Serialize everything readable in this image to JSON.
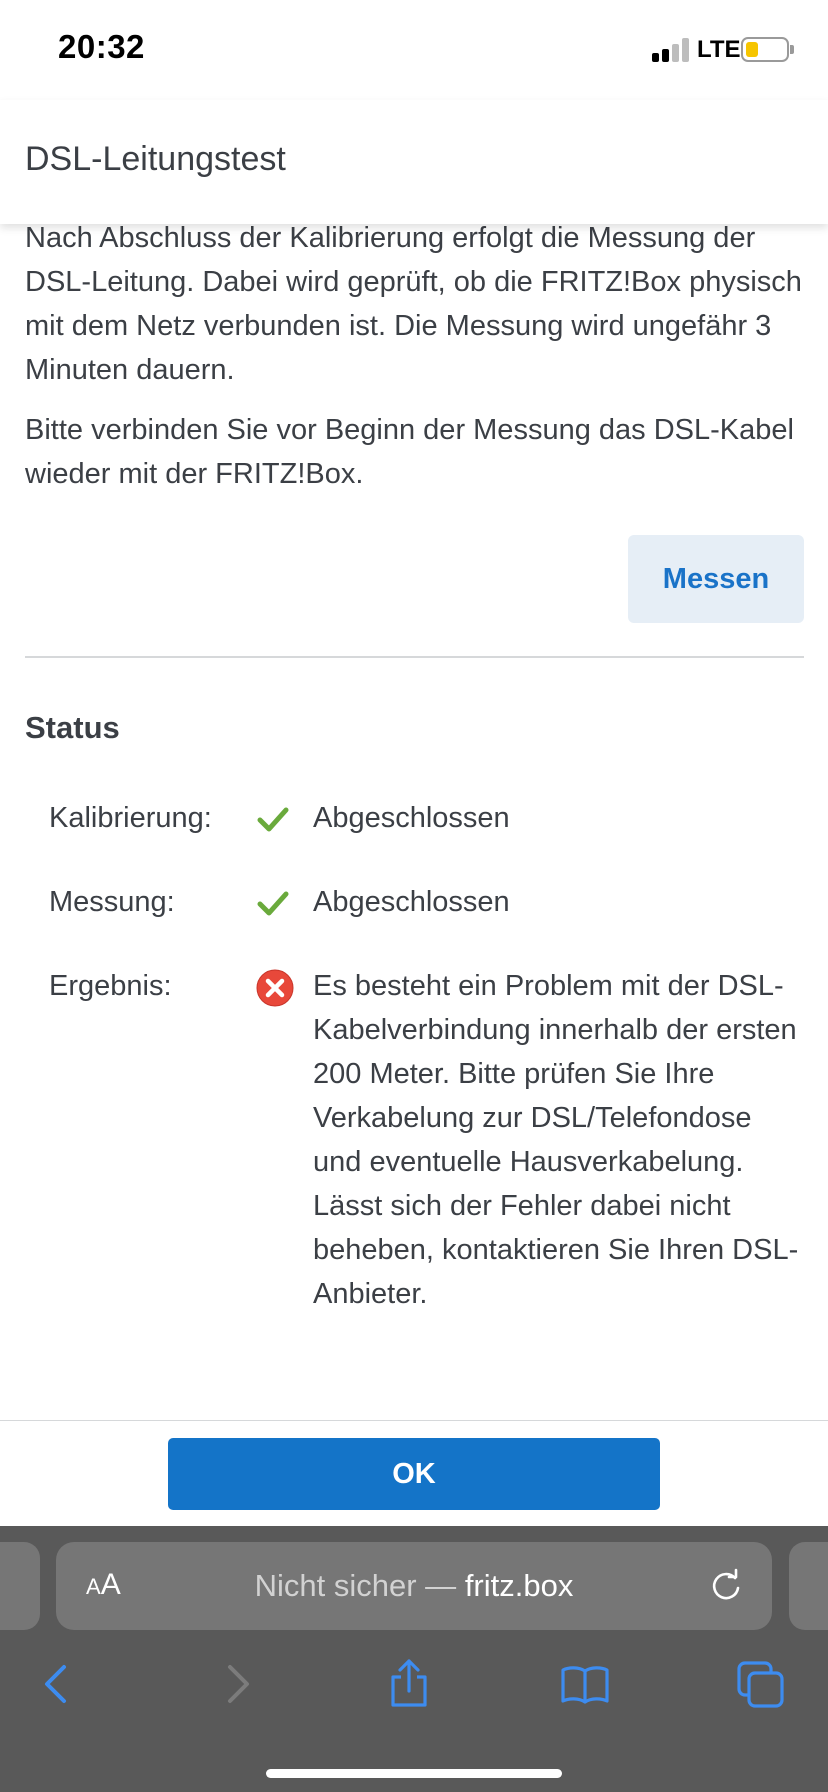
{
  "status_bar": {
    "time": "20:32",
    "network": "LTE",
    "signal_bars_active": 2,
    "signal_bars_total": 4,
    "battery_level": 0.3,
    "battery_color": "#f6c500"
  },
  "header": {
    "title": "DSL-Leitungstest"
  },
  "main": {
    "intro_paragraph": "Nach Abschluss der Kalibrierung erfolgt die Messung der DSL-Leitung. Dabei wird geprüft, ob die FRITZ!Box physisch mit dem Netz verbunden ist. Die Messung wird ungefähr 3 Minuten dauern.",
    "instruction_paragraph": "Bitte verbinden Sie vor Beginn der Messung das DSL-Kabel wieder mit der FRITZ!Box.",
    "measure_button": "Messen",
    "status_heading": "Status",
    "rows": [
      {
        "label": "Kalibrierung:",
        "icon": "check-icon",
        "value": "Abgeschlossen"
      },
      {
        "label": "Messung:",
        "icon": "check-icon",
        "value": "Abgeschlossen"
      },
      {
        "label": "Ergebnis:",
        "icon": "error-icon",
        "value": "Es besteht ein Problem mit der DSL-Kabelverbindung innerhalb der ersten 200 Meter. Bitte prüfen Sie Ihre Verkabelung zur DSL/Telefondose und eventuelle Hausverkabelung. Lässt sich der Fehler dabei nicht beheben, kontaktieren Sie Ihren DSL-Anbieter."
      }
    ]
  },
  "footer": {
    "ok_button": "OK"
  },
  "browser": {
    "text_size_label_big": "A",
    "text_size_label_small": "A",
    "url_prefix": "Nicht sicher — ",
    "url_host": "fritz.box",
    "icons": [
      "back-icon",
      "forward-icon",
      "share-icon",
      "bookmarks-icon",
      "tabs-icon"
    ]
  },
  "colors": {
    "accent": "#1474c8",
    "success": "#6aaa3c",
    "error": "#e8483a",
    "text": "#3b3f45"
  }
}
